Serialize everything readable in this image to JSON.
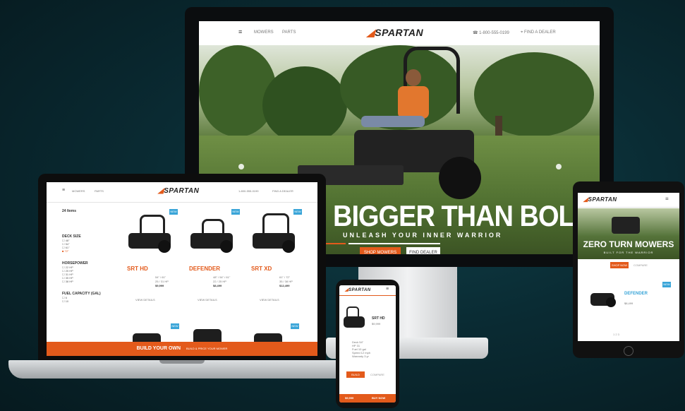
{
  "brand": {
    "logo_text": "SPARTAN",
    "accent_color": "#e35a1b",
    "badge_color": "#3aa5d8"
  },
  "monitor": {
    "nav": {
      "menu_icon": "menu-icon",
      "links": [
        "MOWERS",
        "PARTS"
      ],
      "phone": "1-800-555-0199",
      "dealer": "FIND A DEALER"
    },
    "hero": {
      "title": "BIGGER THAN BOLD",
      "subtitle": "UNLEASH YOUR INNER WARRIOR",
      "primary_cta": "SHOP MOWERS",
      "secondary_cta": "FIND DEALER"
    }
  },
  "laptop": {
    "nav": {
      "links": [
        "MOWERS",
        "PARTS"
      ],
      "phone": "1-800-555-0199",
      "dealer": "FIND A DEALER"
    },
    "sidebar": {
      "results": "24 Items",
      "filters": [
        {
          "title": "DECK SIZE",
          "options": [
            "48\"",
            "54\"",
            "61\"",
            "72\""
          ]
        },
        {
          "title": "HORSEPOWER",
          "options": [
            "22 HP",
            "25 HP",
            "31 HP",
            "35 HP",
            "38 HP"
          ]
        },
        {
          "title": "FUEL CAPACITY (GAL)",
          "options": [
            "6",
            "10"
          ]
        }
      ]
    },
    "products": [
      {
        "name": "SRT HD",
        "badge": "NEW",
        "price": "$9,999",
        "spec_a": "54\" / 61\"",
        "spec_b": "25 / 31 HP",
        "link": "VIEW DETAILS"
      },
      {
        "name": "DEFENDER",
        "badge": "NEW",
        "price": "$8,499",
        "spec_a": "48\" / 54\" / 61\"",
        "spec_b": "22 / 25 HP",
        "link": "VIEW DETAILS"
      },
      {
        "name": "SRT XD",
        "badge": "NEW",
        "price": "$12,499",
        "spec_a": "61\" / 72\"",
        "spec_b": "35 / 38 HP",
        "link": "VIEW DETAILS"
      }
    ],
    "cta_bar": {
      "label": "BUILD YOUR OWN",
      "sub": "BUILD & PRICE YOUR MOWER"
    }
  },
  "tablet": {
    "hero_title": "ZERO TURN MOWERS",
    "hero_sub": "BUILT FOR THE WARRIOR",
    "primary_cta": "SHOP NOW",
    "secondary_cta": "COMPARE",
    "product": {
      "name": "DEFENDER",
      "badge": "NEW",
      "price": "$8,499"
    },
    "pagination": "1  2  3"
  },
  "phone": {
    "product": {
      "name": "SRT HD",
      "price": "$9,999"
    },
    "specs": [
      "Deck 54\"",
      "HP 31",
      "Fuel 10 gal",
      "Speed 12 mph",
      "Warranty 3 yr"
    ],
    "buttons": {
      "primary": "BUILD",
      "secondary": "COMPARE"
    },
    "bottom_bar": {
      "left": "$9,999",
      "right": "BUY NOW"
    }
  }
}
